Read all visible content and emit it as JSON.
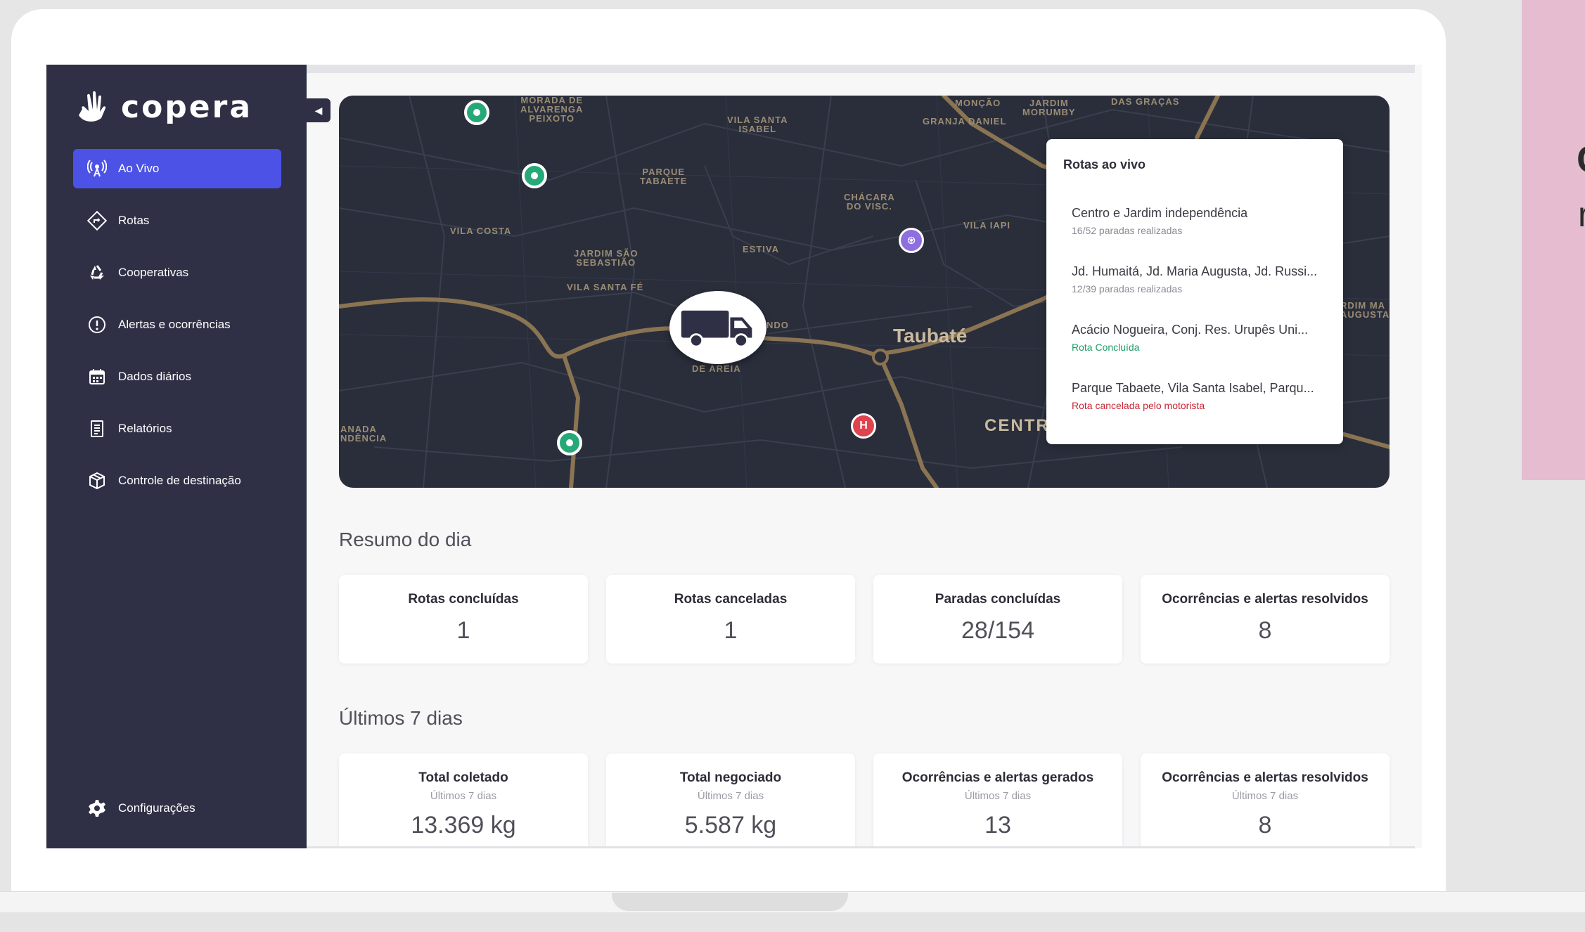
{
  "brand": {
    "name": "copera"
  },
  "sidebar": {
    "items": [
      {
        "label": "Ao Vivo",
        "icon": "live-broadcast-icon",
        "active": true
      },
      {
        "label": "Rotas",
        "icon": "route-diamond-icon",
        "active": false
      },
      {
        "label": "Cooperativas",
        "icon": "recycle-icon",
        "active": false
      },
      {
        "label": "Alertas e ocorrências",
        "icon": "alert-circle-icon",
        "active": false
      },
      {
        "label": "Dados diários",
        "icon": "calendar-icon",
        "active": false
      },
      {
        "label": "Relatórios",
        "icon": "report-icon",
        "active": false
      },
      {
        "label": "Controle de destinação",
        "icon": "package-icon",
        "active": false
      }
    ],
    "settings_label": "Configurações"
  },
  "map": {
    "labels": {
      "alvarenga": "MORADA DE\nALVARENGA\nPEIXOTO",
      "vila_santa_isabel": "VILA SANTA\nISABEL",
      "monção": "MONÇÃO",
      "jardim_morumby": "JARDIM\nMORUMBY",
      "das_gracas": "DAS GRAÇAS",
      "granja_daniel": "GRANJA DANIEL",
      "parque_tabaete": "PARQUE\nTABAETE",
      "chacara": "CHÁCARA\nDO VISC.",
      "vila_costa": "VILA COSTA",
      "vila_iapi": "VILA IAPI",
      "jardim_sao_sebastiao": "JARDIM SÃO\nSEBASTIÃO",
      "estiva": "ESTIVA",
      "vila_santa_fe": "VILA SANTA FÉ",
      "ndo": "NDO",
      "de_areia": "DE AREIA",
      "jardim_ma": "RDIM MA\nAUGUSTA",
      "anada": "ANADA\nNDÊNCIA",
      "centro": "CENTR"
    },
    "city": "Taubaté",
    "pin_labels": {
      "hospital": "H"
    }
  },
  "live_routes": {
    "title": "Rotas ao vivo",
    "routes": [
      {
        "name": "Centro e Jardim independência",
        "status": "16/52 paradas realizadas",
        "kind": "progress"
      },
      {
        "name": "Jd. Humaitá, Jd. Maria Augusta, Jd. Russi...",
        "status": "12/39 paradas realizadas",
        "kind": "progress"
      },
      {
        "name": "Acácio Nogueira, Conj. Res. Urupês Uni...",
        "status": "Rota Concluída",
        "kind": "done"
      },
      {
        "name": "Parque Tabaete, Vila Santa Isabel, Parqu...",
        "status": "Rota cancelada pelo motorista",
        "kind": "cancel"
      }
    ]
  },
  "summary": {
    "title": "Resumo do dia",
    "cards": [
      {
        "title": "Rotas concluídas",
        "value": "1"
      },
      {
        "title": "Rotas canceladas",
        "value": "1"
      },
      {
        "title": "Paradas concluídas",
        "value": "28/154"
      },
      {
        "title": "Ocorrências e alertas resolvidos",
        "value": "8"
      }
    ]
  },
  "last7": {
    "title": "Últimos 7 dias",
    "cards": [
      {
        "title": "Total coletado",
        "sub": "Últimos 7 dias",
        "value": "13.369 kg"
      },
      {
        "title": "Total negociado",
        "sub": "Últimos 7 dias",
        "value": "5.587 kg"
      },
      {
        "title": "Ocorrências e alertas gerados",
        "sub": "Últimos 7 dias",
        "value": "13"
      },
      {
        "title": "Ocorrências e alertas resolvidos",
        "sub": "Últimos 7 dias",
        "value": "8"
      }
    ]
  },
  "side_panel": {
    "char1": "C",
    "char2": "r"
  },
  "colors": {
    "sidebar": "#2f3045",
    "active": "#4c52e5",
    "map": "#2a2e3b",
    "done": "#1f9d6a",
    "cancel": "#c62839",
    "pink": "#e6bdd0"
  }
}
